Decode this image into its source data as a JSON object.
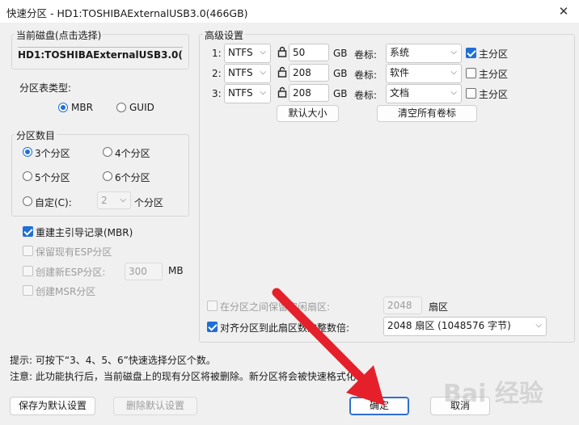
{
  "window": {
    "title": "快速分区 - HD1:TOSHIBAExternalUSB3.0(466GB)",
    "close": "✕"
  },
  "current_disk": {
    "legend": "当前磁盘(点击选择)",
    "value": "HD1:TOSHIBAExternalUSB3.0(466"
  },
  "partition_table": {
    "label": "分区表类型:",
    "options": [
      "MBR",
      "GUID"
    ],
    "selected": "MBR"
  },
  "partition_count": {
    "legend": "分区数目",
    "options": [
      "3个分区",
      "4个分区",
      "5个分区",
      "6个分区"
    ],
    "selected": "3个分区",
    "custom_label": "自定(C):",
    "custom_value": "2",
    "custom_unit": "个分区"
  },
  "boot": {
    "rebuild_mbr": "重建主引导记录(MBR)",
    "keep_esp": "保留现有ESP分区",
    "create_esp": "创建新ESP分区:",
    "esp_size": "300",
    "esp_unit": "MB",
    "create_msr": "创建MSR分区"
  },
  "advanced": {
    "legend": "高级设置",
    "rows": [
      {
        "index": "1:",
        "fs": "NTFS",
        "size": "50",
        "unit": "GB",
        "label_caption": "卷标:",
        "label": "系统",
        "primary": "主分区",
        "primary_checked": true,
        "locked": true
      },
      {
        "index": "2:",
        "fs": "NTFS",
        "size": "208",
        "unit": "GB",
        "label_caption": "卷标:",
        "label": "软件",
        "primary": "主分区",
        "primary_checked": false,
        "locked": false
      },
      {
        "index": "3:",
        "fs": "NTFS",
        "size": "208",
        "unit": "GB",
        "label_caption": "卷标:",
        "label": "文档",
        "primary": "主分区",
        "primary_checked": false,
        "locked": false
      }
    ],
    "default_size_btn": "默认大小",
    "clear_labels_btn": "清空所有卷标",
    "reserve_label": "在分区之间保留空闲扇区:",
    "reserve_value": "2048",
    "reserve_unit": "扇区",
    "align_label": "对齐分区到此扇区数的整数倍:",
    "align_value": "2048 扇区 (1048576 字节)"
  },
  "hints": {
    "tip": "提示: 可按下“3、4、5、6”快速选择分区个数。",
    "note": "注意: 此功能执行后，当前磁盘上的现有分区将被删除。新分区将会被快速格式化"
  },
  "buttons": {
    "save_default": "保存为默认设置",
    "delete_default": "删除默认设置",
    "ok": "确定",
    "cancel": "取消"
  },
  "watermark": "Bai 经验",
  "colors": {
    "accent": "#1f6fd6",
    "arrow": "#e5202a"
  }
}
